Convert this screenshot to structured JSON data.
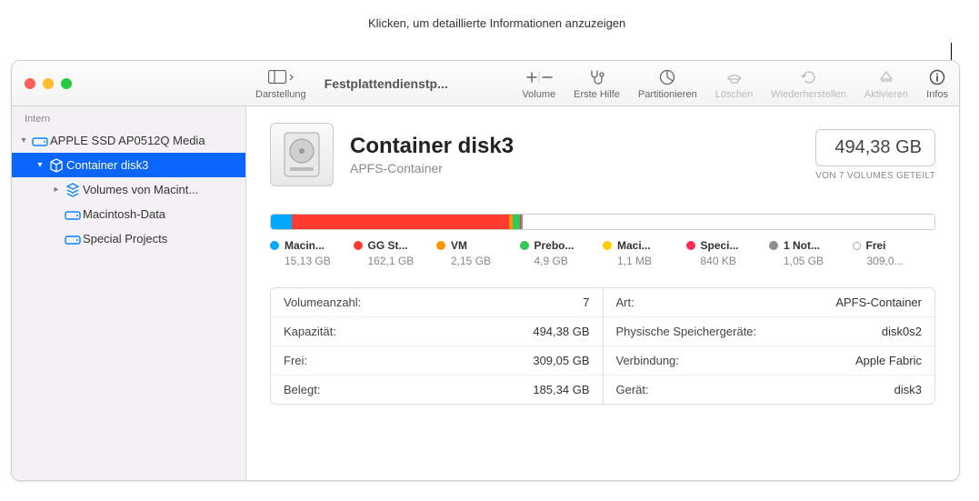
{
  "annotation": "Klicken, um detaillierte Informationen anzuzeigen",
  "toolbar": {
    "view": "Darstellung",
    "title": "Festplattendienstp...",
    "volume": "Volume",
    "firstaid": "Erste Hilfe",
    "partition": "Partitionieren",
    "erase": "Löschen",
    "restore": "Wiederherstellen",
    "activate": "Aktivieren",
    "info": "Infos"
  },
  "sidebar": {
    "header": "Intern",
    "items": [
      {
        "label": "APPLE SSD AP0512Q Media"
      },
      {
        "label": "Container disk3"
      },
      {
        "label": "Volumes von Macint..."
      },
      {
        "label": "Macintosh-Data"
      },
      {
        "label": "Special Projects"
      }
    ]
  },
  "main": {
    "title": "Container disk3",
    "subtitle": "APFS-Container",
    "capacity": "494,38 GB",
    "capacity_sub": "VON 7 VOLUMES GETEILT"
  },
  "segments": [
    {
      "label": "Macin...",
      "size": "15,13 GB",
      "color": "#00a8ff",
      "width": "3.1"
    },
    {
      "label": "GG St...",
      "size": "162,1 GB",
      "color": "#ff3b30",
      "width": "32.8"
    },
    {
      "label": "VM",
      "size": "2,15 GB",
      "color": "#ff9500",
      "width": "0.6"
    },
    {
      "label": "Prebo...",
      "size": "4,9 GB",
      "color": "#34c759",
      "width": "1.0"
    },
    {
      "label": "Maci...",
      "size": "1,1 MB",
      "color": "#ffcc00",
      "width": "0.1"
    },
    {
      "label": "Speci...",
      "size": "840 KB",
      "color": "#ff2d55",
      "width": "0.1"
    },
    {
      "label": "1 Not...",
      "size": "1,05 GB",
      "color": "#8e8e93",
      "width": "0.3"
    },
    {
      "label": "Frei",
      "size": "309,0...",
      "color": "empty",
      "width": "62.0"
    }
  ],
  "details": {
    "left": [
      {
        "k": "Volumeanzahl:",
        "v": "7"
      },
      {
        "k": "Kapazität:",
        "v": "494,38 GB"
      },
      {
        "k": "Frei:",
        "v": "309,05 GB"
      },
      {
        "k": "Belegt:",
        "v": "185,34 GB"
      }
    ],
    "right": [
      {
        "k": "Art:",
        "v": "APFS-Container"
      },
      {
        "k": "Physische Speichergeräte:",
        "v": "disk0s2"
      },
      {
        "k": "Verbindung:",
        "v": "Apple Fabric"
      },
      {
        "k": "Gerät:",
        "v": "disk3"
      }
    ]
  }
}
